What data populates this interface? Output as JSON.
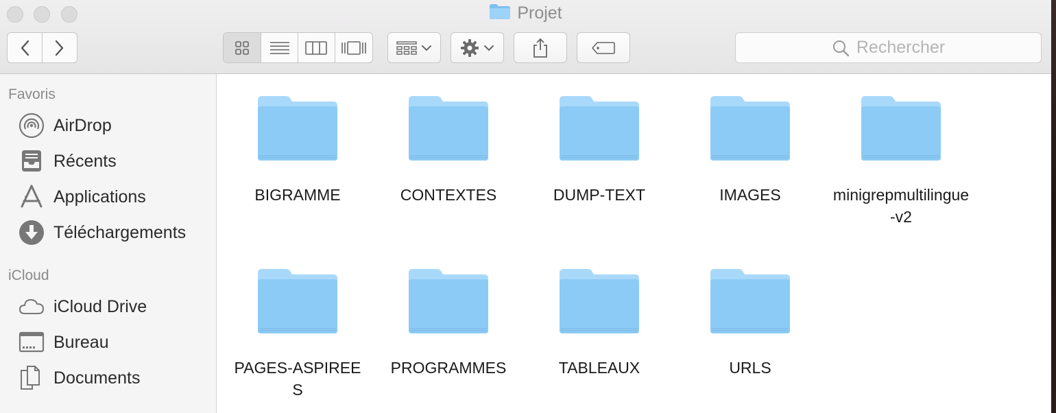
{
  "window": {
    "title": "Projet"
  },
  "toolbar": {
    "back_icon": "chevron-left-icon",
    "forward_icon": "chevron-right-icon",
    "view_modes": [
      "icon-view",
      "list-view",
      "column-view",
      "cover-flow-view"
    ],
    "active_view": "icon-view",
    "group_icon": "group-grid-icon",
    "action_icon": "gear-icon",
    "share_icon": "share-icon",
    "tag_icon": "tag-icon"
  },
  "search": {
    "placeholder": "Rechercher"
  },
  "sidebar": {
    "favorites_header": "Favoris",
    "favorites": [
      {
        "label": "AirDrop",
        "icon": "airdrop-icon"
      },
      {
        "label": "Récents",
        "icon": "recents-icon"
      },
      {
        "label": "Applications",
        "icon": "applications-icon"
      },
      {
        "label": "Téléchargements",
        "icon": "downloads-icon"
      }
    ],
    "icloud_header": "iCloud",
    "icloud": [
      {
        "label": "iCloud Drive",
        "icon": "cloud-icon"
      },
      {
        "label": "Bureau",
        "icon": "desktop-icon"
      },
      {
        "label": "Documents",
        "icon": "documents-icon"
      }
    ]
  },
  "folders": [
    {
      "name": "BIGRAMME"
    },
    {
      "name": "CONTEXTES"
    },
    {
      "name": "DUMP-TEXT"
    },
    {
      "name": "IMAGES"
    },
    {
      "name": "minigrepmultilingue-v2"
    },
    {
      "name": "PAGES-ASPIREES"
    },
    {
      "name": "PROGRAMMES"
    },
    {
      "name": "TABLEAUX"
    },
    {
      "name": "URLS"
    }
  ],
  "colors": {
    "folder_front": "#8ccbf5",
    "folder_back": "#a9d9fa",
    "sidebar_bg": "#f5f5f5",
    "titlebar_bg": "#e8e7e8"
  }
}
